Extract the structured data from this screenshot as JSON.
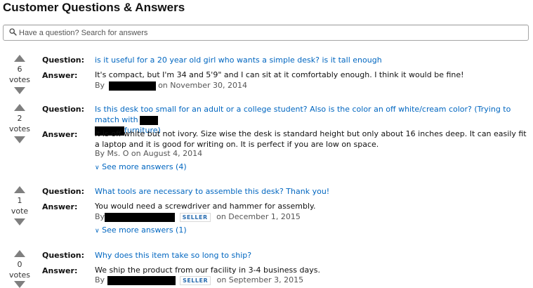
{
  "page": {
    "title": "Customer Questions & Answers"
  },
  "search": {
    "placeholder": "Have a question? Search for answers",
    "value": ""
  },
  "labels": {
    "question": "Question:",
    "answer": "Answer:",
    "by": "By",
    "seller": "SELLER"
  },
  "items": [
    {
      "votes": "6",
      "votes_label": "votes",
      "question": "is it useful for a 20 year old girl who wants a simple desk? is it tall enough",
      "answer": "It's compact, but I'm 34 and 5'9\" and I can sit at it comfortably enough. I think it would be fine!",
      "byline_suffix": "on November 30, 2014"
    },
    {
      "votes": "2",
      "votes_label": "votes",
      "question_part1": "Is this desk too small for an adult or a college student? Also is the color an off white/cream color? (Trying to match with",
      "question_part2": "furniture)",
      "answer": "It is off white but not ivory. Size wise the desk is standard height but only about 16 inches deep. It can easily fit a laptop and it is good for writing on. It is perfect if you are low on space.",
      "byline": "By Ms. O on August 4, 2014",
      "see_more": "See more answers (4)"
    },
    {
      "votes": "1",
      "votes_label": "vote",
      "question": "What tools are necessary to assemble this desk? Thank you!",
      "answer": "You would need a screwdriver and hammer for assembly.",
      "byline_suffix": "on December 1, 2015",
      "see_more": "See more answers (1)"
    },
    {
      "votes": "0",
      "votes_label": "votes",
      "question": "Why does this item take so long to ship?",
      "answer": "We ship the product from our facility in 3-4 business days.",
      "byline_suffix": "on September 3, 2015"
    }
  ],
  "colors": {
    "link": "#0066c0",
    "vote_arrow": "#7f7f7f",
    "redaction": "#000000"
  },
  "icons": {
    "search": "magnifier-icon",
    "vote_up": "triangle-up-icon",
    "vote_down": "triangle-down-icon",
    "expand": "chevron-down-icon"
  }
}
